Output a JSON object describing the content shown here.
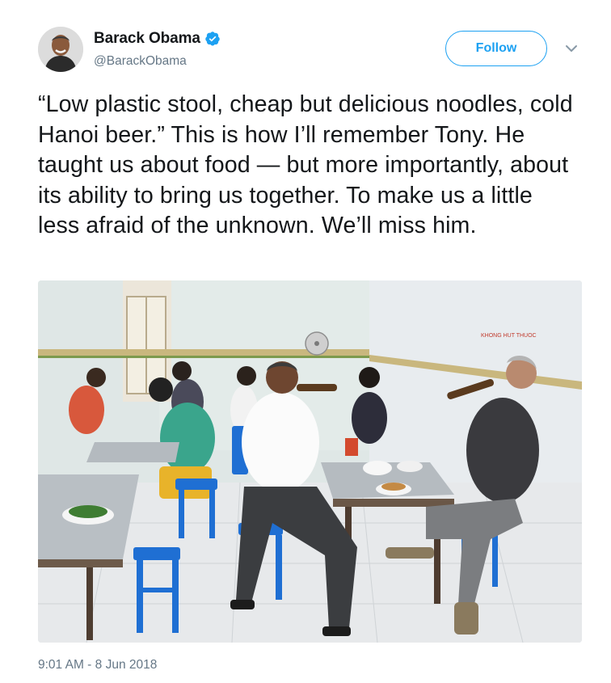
{
  "author": {
    "name": "Barack Obama",
    "handle": "@BarackObama",
    "verified": true,
    "avatar_icon": "profile-photo"
  },
  "actions": {
    "follow_label": "Follow",
    "menu_icon": "chevron-down-icon"
  },
  "tweet": {
    "text": "“Low plastic stool, cheap but delicious noodles, cold Hanoi beer.” This is how I’ll remember Tony. He taught us about food — but more importantly, about its ability to bring us together. To make us a little less afraid of the unknown. We’ll miss him.",
    "timestamp": "9:01 AM - 8 Jun 2018"
  },
  "photo": {
    "wall_sign": "KHONG HUT THUOC"
  },
  "colors": {
    "accent": "#1da1f2",
    "text": "#14171a",
    "secondary": "#657786"
  }
}
